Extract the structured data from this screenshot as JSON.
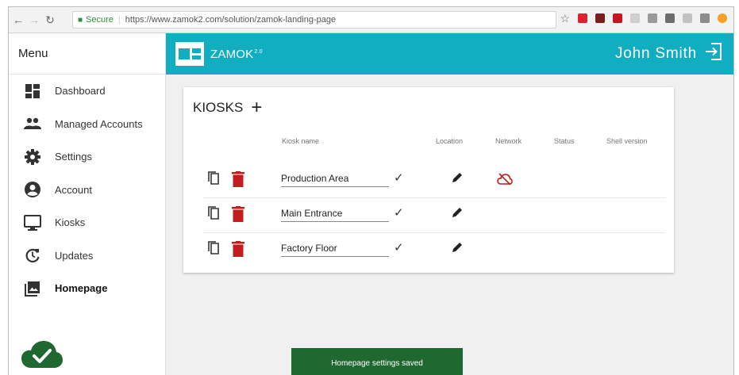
{
  "browser": {
    "secure_label": "Secure",
    "separator": "|",
    "url": "https://www.zamok2.com/solution/zamok-landing-page"
  },
  "sidebar": {
    "title": "Menu",
    "items": [
      {
        "label": "Dashboard",
        "icon": "dashboard-icon"
      },
      {
        "label": "Managed Accounts",
        "icon": "people-icon"
      },
      {
        "label": "Settings",
        "icon": "gear-icon"
      },
      {
        "label": "Account",
        "icon": "account-circle-icon"
      },
      {
        "label": "Kiosks",
        "icon": "monitor-icon"
      },
      {
        "label": "Updates",
        "icon": "update-icon"
      },
      {
        "label": "Homepage",
        "icon": "photo-library-icon",
        "active": true
      }
    ]
  },
  "header": {
    "brand": "ZAMOK",
    "brand_sup": "2.0",
    "user_name": "John Smith",
    "accent_color": "#11adc0"
  },
  "kiosks": {
    "title": "KIOSKS",
    "columns": {
      "name": "Kiosk name",
      "location": "Location",
      "network": "Network",
      "status": "Status",
      "shell": "Shell version"
    },
    "rows": [
      {
        "name": "Production Area",
        "network_icon": "cloud-off-icon"
      },
      {
        "name": "Main Entrance"
      },
      {
        "name": "Factory Floor"
      }
    ]
  },
  "toast": {
    "message": "Homepage settings saved",
    "color": "#1f6930"
  }
}
